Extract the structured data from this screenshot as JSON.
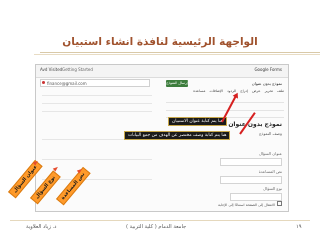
{
  "slide": {
    "title": "الواجهة الرئيسية لنافذة انشاء استبيان"
  },
  "app": {
    "menubar": {
      "user": "Avd Visited",
      "getting_started": "Getting Started",
      "forms_label": "Google Forms"
    },
    "account_email": "finance@gmail.com",
    "form_tabs": [
      "ملف",
      "تحرير",
      "عرض",
      "إدراج",
      "الردود",
      "الإضافات",
      "مساعدة"
    ],
    "save_button": "إرسال النموذج",
    "form_title_small": "نموذج بدون عنوان",
    "form_heading": "نموذج بدون عنوان",
    "form_description_placeholder": "وصف النموذج",
    "question_title_label": "عنوان السؤال",
    "help_text_label": "نص المساعدة",
    "question_type_label": "نوع السؤال",
    "required_checkbox_label": "الانتقال إلى الصفحة استنادًا إلى الإجابة"
  },
  "callouts": {
    "title_hint": "هنا يتم كتابة عنوان الاستبيان",
    "description_hint": "هنا يتم كتابة وصف مختصر عن الهدف من جمع البيانات"
  },
  "tags": {
    "tag_a": "عنوان السؤال",
    "tag_b": "نوع السؤال",
    "tag_c": "نص المساعدة"
  },
  "footer": {
    "author": "د. زياد العلاوية",
    "institution": "جامعة الدمام ( كلية التربية )",
    "page_number": "١٩"
  },
  "colors": {
    "title": "#a0522d",
    "callout_bg": "#1a1a1a",
    "tag_bg": "#ff9a2a",
    "arrow": "#d62020",
    "save_button": "#3d7d3d"
  }
}
